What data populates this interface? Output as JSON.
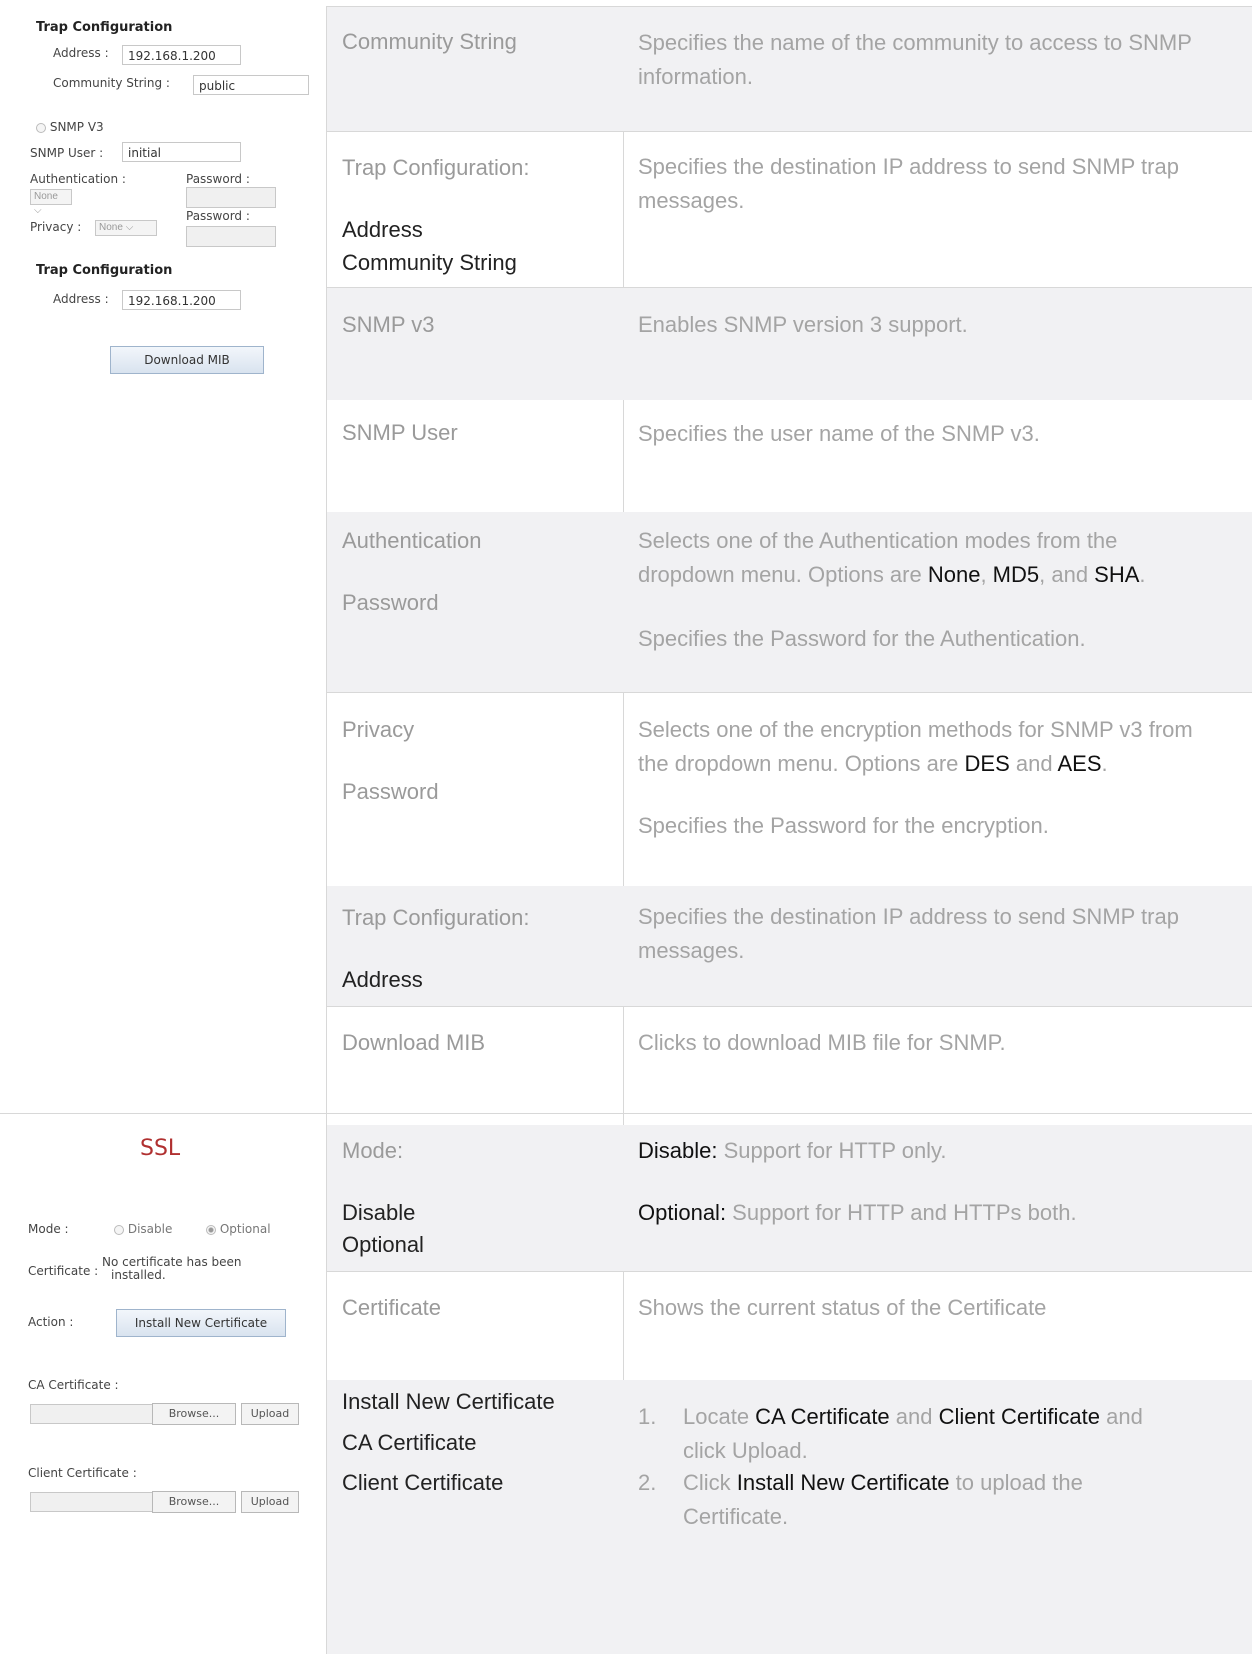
{
  "snmp_panel": {
    "trap_config_title": "Trap Configuration",
    "address_label": "Address :",
    "address_value": "192.168.1.200",
    "community_label": "Community String :",
    "community_value": "public",
    "snmpv3_label": "SNMP V3",
    "user_label": "SNMP User :",
    "user_value": "initial",
    "auth_label": "Authentication :",
    "auth_select": "None",
    "password_label_1": "Password :",
    "privacy_label": "Privacy :",
    "privacy_select": "None",
    "password_label_2": "Password :",
    "trap_config_title_2": "Trap Configuration",
    "address_label_2": "Address :",
    "address_value_2": "192.168.1.200",
    "download_mib_button": "Download MIB"
  },
  "ssl_panel": {
    "title": "SSL",
    "mode_label": "Mode :",
    "mode_disable": "Disable",
    "mode_optional": "Optional",
    "certificate_label": "Certificate :",
    "certificate_status_line1": "No certificate has been",
    "certificate_status_line2": "installed.",
    "action_label": "Action :",
    "install_button": "Install New Certificate",
    "ca_label": "CA Certificate :",
    "client_label": "Client Certificate :",
    "browse_label": "Browse...",
    "upload_label": "Upload"
  },
  "rows": [
    {
      "term": "Community String",
      "desc": "Specifies the name of the community to access to SNMP information."
    },
    {
      "term": "Trap Configuration:",
      "sub1": "Address",
      "sub2": "Community String",
      "desc": "Specifies the destination IP address to send SNMP trap messages."
    },
    {
      "term": "SNMP v3",
      "desc": "Enables SNMP version 3 support."
    },
    {
      "term": "SNMP User",
      "desc": "Specifies the user name of the SNMP v3."
    },
    {
      "term": "Authentication",
      "term2": "Password",
      "desc_a": "Selects one of the Authentication modes from the dropdown menu. Options are ",
      "opt1": "None",
      "sep1": ", ",
      "opt2": "MD5",
      "sep2": ", and ",
      "opt3": "SHA",
      "end": ".",
      "desc_b": "Specifies the Password for the Authentication."
    },
    {
      "term": "Privacy",
      "term2": "Password",
      "desc_a": "Selects one of the encryption methods for SNMP v3 from the dropdown menu. Options are ",
      "opt1": "DES",
      "sep1": " and ",
      "opt2": "AES",
      "end": ".",
      "desc_b": "Specifies the Password for the encryption."
    },
    {
      "term": "Trap Configuration:",
      "sub1": "Address",
      "desc": "Specifies the destination IP address to send SNMP trap messages."
    },
    {
      "term": "Download MIB",
      "desc": "Clicks to download MIB file for SNMP."
    },
    {
      "term": "Mode:",
      "sub1": "Disable",
      "sub2": "Optional",
      "desc1_key": "Disable:",
      "desc1": " Support for HTTP only.",
      "desc2_key": "Optional:",
      "desc2": " Support for HTTP and HTTPs both."
    },
    {
      "term": "Certificate",
      "desc": "Shows the current status of the Certificate"
    },
    {
      "term": "Install New Certificate",
      "term2": "CA Certificate",
      "term3": "Client Certificate",
      "step1_num": "1.",
      "step1_a": "Locate ",
      "step1_b": "CA Certificate",
      "step1_c": " and ",
      "step1_d": "Client Certificate",
      "step1_e": " and click Upload.",
      "step2_num": "2.",
      "step2_a": "Click ",
      "step2_b": "Install New Certificate",
      "step2_c": " to upload the Certificate."
    }
  ]
}
